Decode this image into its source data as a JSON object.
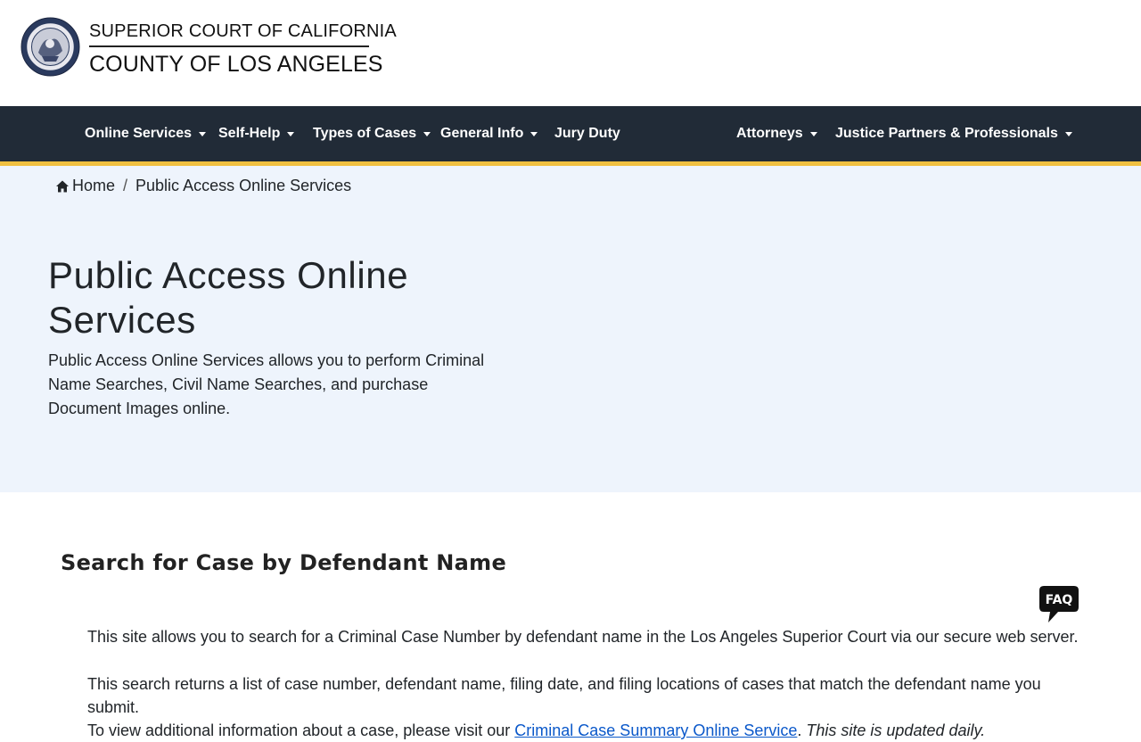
{
  "header": {
    "logo_line1": "SUPERIOR COURT OF CALIFORNIA",
    "logo_line2": "COUNTY OF LOS ANGELES",
    "seal_icon": "court-seal-icon"
  },
  "nav": {
    "items": [
      {
        "label": "Online Services",
        "dropdown": true
      },
      {
        "label": "Self-Help",
        "dropdown": true
      },
      {
        "label": "Types of Cases",
        "dropdown": true
      },
      {
        "label": "General Info",
        "dropdown": true
      },
      {
        "label": "Jury Duty",
        "dropdown": false
      },
      {
        "label": "Attorneys",
        "dropdown": true
      },
      {
        "label": "Justice Partners & Professionals",
        "dropdown": true
      }
    ]
  },
  "breadcrumb": {
    "home": "Home",
    "separator": "/",
    "current": "Public Access Online Services"
  },
  "hero": {
    "title": "Public Access Online Services",
    "description": "Public Access Online Services allows you to perform Criminal Name Searches, Civil Name Searches, and purchase Document Images online."
  },
  "content": {
    "section_title": "Search for Case by Defendant Name",
    "faq_label": "FAQ",
    "para1": "This site allows you to search for a Criminal Case Number by defendant name in the Los Angeles Superior Court via our secure web server.",
    "para2_part1": "This search returns a list of case number, defendant name, filing date, and filing locations of cases that match the defendant name you submit.",
    "para2_part2": "To view additional information about a case, please visit our ",
    "para2_link": "Criminal Case Summary Online Service",
    "para2_part3": ". ",
    "para2_italic": "This site is updated daily."
  },
  "colors": {
    "nav_bg": "#212b37",
    "nav_accent": "#f0c040",
    "hero_bg": "#eef4fc",
    "link": "#0a58ca"
  }
}
